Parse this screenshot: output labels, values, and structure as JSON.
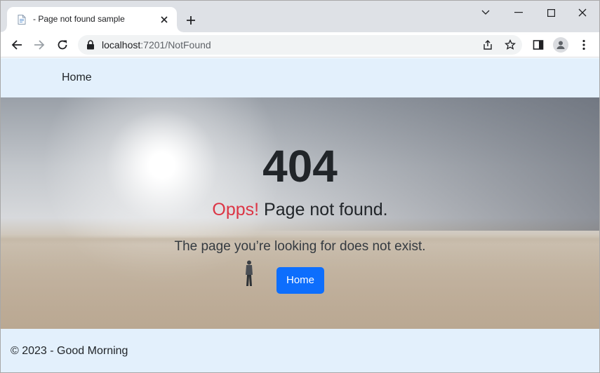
{
  "browser": {
    "tab": {
      "title": "- Page not found sample",
      "favicon": "document-icon"
    },
    "address": {
      "host": "localhost",
      "path": ":7201/NotFound"
    },
    "icons": {
      "back": "arrow-left-icon",
      "forward": "arrow-right-icon",
      "reload": "reload-icon",
      "lock": "lock-icon",
      "share": "share-icon",
      "bookmark": "star-icon",
      "side_panel": "side-panel-icon",
      "profile": "profile-icon",
      "menu": "kebab-menu-icon"
    }
  },
  "site": {
    "nav": {
      "home_label": "Home"
    },
    "hero": {
      "code": "404",
      "title_highlight": "Opps!",
      "title_rest": " Page not found.",
      "message": "The page you’re looking for does not exist.",
      "button_label": "Home"
    },
    "footer": {
      "text": "© 2023 - Good Morning"
    }
  },
  "colors": {
    "accent": "#0d6efd",
    "error": "#dc3545",
    "nav_bg": "#e3f0fc"
  }
}
